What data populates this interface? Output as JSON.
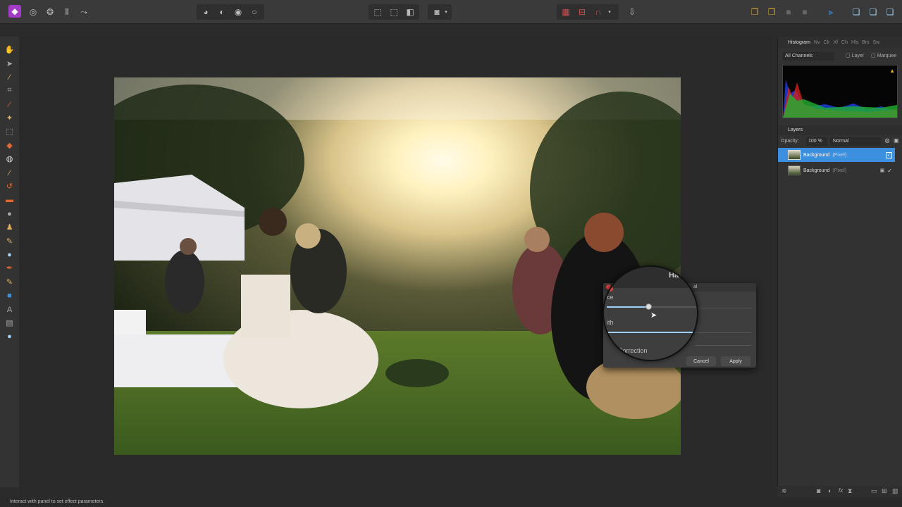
{
  "status": {
    "hint": "Interact with panel to set effect parameters."
  },
  "histogram": {
    "tabs": [
      "Histogram",
      "Nv",
      "Clr",
      "Xf",
      "Ch",
      "Hls",
      "Brs",
      "Sw"
    ],
    "channel_select": "All Channels",
    "opt_layer": "Layer",
    "opt_marquee": "Marquee"
  },
  "layers": {
    "title": "Layers",
    "opacity_label": "Opacity:",
    "opacity_value": "100 %",
    "blend_mode": "Normal",
    "items": [
      {
        "name": "Background",
        "type": "(Pixel)"
      },
      {
        "name": "Background",
        "type": "(Pixel)"
      }
    ]
  },
  "dialog": {
    "title_fragment": "Ha",
    "title_right": "al",
    "label1": "ce",
    "label2": "ith",
    "label3": "Correction",
    "cancel": "Cancel",
    "apply": "Apply"
  },
  "colors": {
    "accent": "#3d8fe0",
    "panel": "#323232",
    "topbar": "#3a3a3a",
    "persona": "#a23cc7"
  }
}
